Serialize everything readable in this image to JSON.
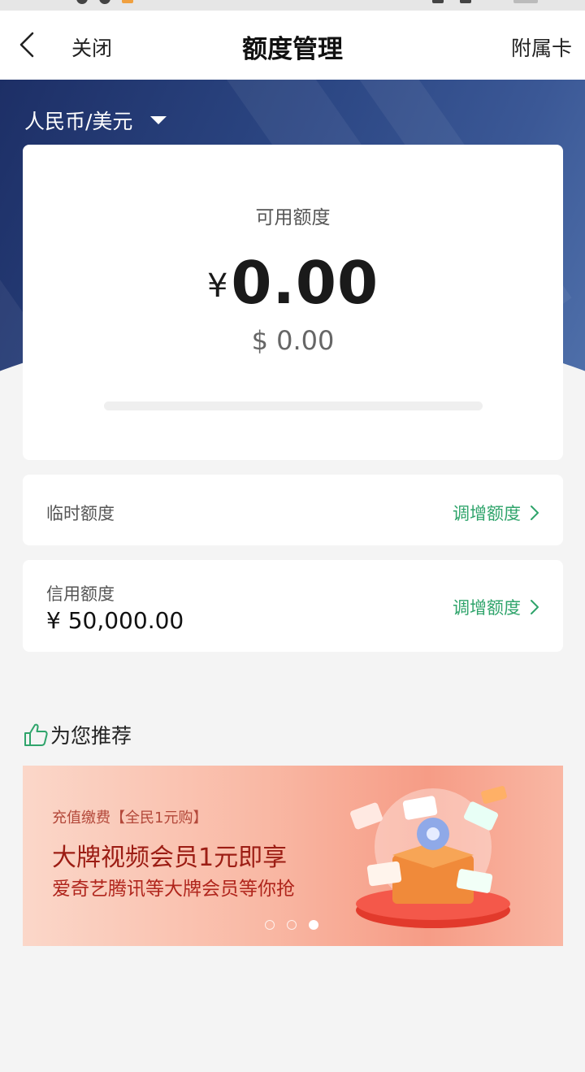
{
  "nav": {
    "close_label": "关闭",
    "title": "额度管理",
    "supplementary_label": "附属卡"
  },
  "currency_selector": {
    "label": "人民币/美元"
  },
  "available": {
    "label": "可用额度",
    "cny_symbol": "¥",
    "cny_amount": "0.00",
    "usd_amount": "$ 0.00",
    "usage_fraction": 0
  },
  "temporary": {
    "label": "临时额度",
    "action_label": "调增额度"
  },
  "credit": {
    "label": "信用额度",
    "value": "¥ 50,000.00",
    "action_label": "调增额度"
  },
  "recommend": {
    "title": "为您推荐",
    "banner": {
      "tag": "充值缴费【全民1元购】",
      "headline": "大牌视频会员1元即享",
      "subline": "爱奇艺腾讯等大牌会员等你抢",
      "page_count": 3,
      "active_page": 3
    }
  },
  "colors": {
    "accent_green": "#2fa46b",
    "hero_blue": "#2c4784",
    "banner_red": "#9c1d14"
  }
}
